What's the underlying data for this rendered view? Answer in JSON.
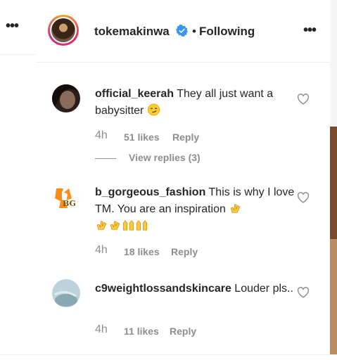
{
  "header": {
    "username": "tokemakinwa",
    "separator": "•",
    "follow_status": "Following",
    "more_icon": "more-horizontal-icon",
    "verified_icon": "verified-badge-icon"
  },
  "left_panel": {
    "more_icon": "more-horizontal-icon"
  },
  "comments": [
    {
      "username": "official_keerah",
      "text": " They all just want a babysitter",
      "emoji_suffix": "smirk-emoji",
      "time": "4h",
      "likes": "51 likes",
      "reply_label": "Reply",
      "view_replies": "View replies (3)"
    },
    {
      "username": "b_gorgeous_fashion",
      "text": " This is why I love TM. You are an inspiration",
      "emoji_suffix": "clapping-hands-emoji x3, raised-hands-emoji x2",
      "time": "4h",
      "likes": "18 likes",
      "reply_label": "Reply"
    },
    {
      "username": "c9weightlossandskincare",
      "text": " Louder pls..",
      "time": "4h",
      "likes": "11 likes",
      "reply_label": "Reply"
    }
  ],
  "colors": {
    "text": "#262626",
    "secondary": "#8e8e8e",
    "verified": "#3897f0",
    "divider": "#efefef"
  }
}
